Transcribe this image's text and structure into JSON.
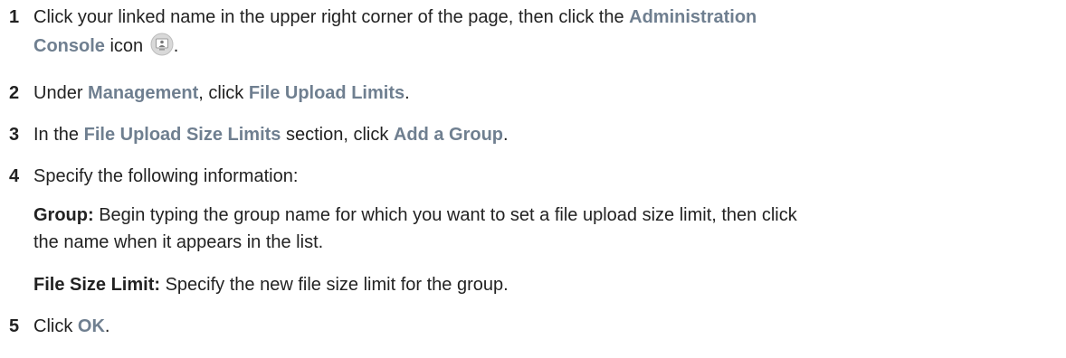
{
  "steps": [
    {
      "number": "1",
      "text_a": "Click your linked name in the upper right corner of the page, then click the",
      "ui_a": "Administration",
      "ui_b": "Console",
      "text_b": "icon",
      "icon": "administration-console-icon",
      "end": "."
    },
    {
      "number": "2",
      "text_a": "Under",
      "ui_a": "Management",
      "text_b": ", click",
      "ui_b": "File Upload Limits",
      "end": "."
    },
    {
      "number": "3",
      "text_a": "In the",
      "ui_a": "File Upload Size Limits",
      "text_b": "section, click",
      "ui_b": "Add a Group",
      "end": "."
    },
    {
      "number": "4",
      "text_a": "Specify the following information:",
      "fields": [
        {
          "label": "Group:",
          "description_line1": "Begin typing the group name for which you want to set a file upload size limit, then click",
          "description_line2": "the name when it appears in the list."
        },
        {
          "label": "File Size Limit:",
          "description": "Specify the new file size limit for the group."
        }
      ]
    },
    {
      "number": "5",
      "text_a": "Click",
      "ui_a": "OK",
      "end": "."
    }
  ],
  "colors": {
    "ui_text": "#6f7f90",
    "body_text": "#222222"
  }
}
